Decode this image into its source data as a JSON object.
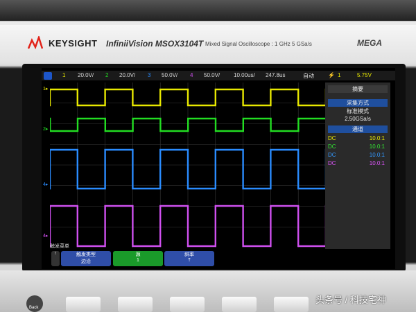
{
  "brand": {
    "name": "KEYSIGHT",
    "model": "InfiniiVision MSOX3104T",
    "spec": "Mixed Signal Oscilloscope : 1 GHz   5 GSa/s",
    "mega": "MEGA"
  },
  "status": {
    "ch1_num": "1",
    "ch1_scale": "20.0V/",
    "ch2_num": "2",
    "ch2_scale": "20.0V/",
    "ch3_num": "3",
    "ch3_scale": "50.0V/",
    "ch4_num": "4",
    "ch4_scale": "50.0V/",
    "timebase": "10.00us/",
    "delay": "247.8us",
    "mode": "自动",
    "trig_ch": "1",
    "trig_level": "5.75V"
  },
  "panel": {
    "title": "摘要",
    "acq_header": "采集方式",
    "acq_mode": "标准模式",
    "sample_rate": "2.50GSa/s",
    "chan_header": "通道",
    "channels": [
      {
        "coupling": "DC",
        "probe": "10.0:1",
        "color": "#f0f000"
      },
      {
        "coupling": "DC",
        "probe": "10.0:1",
        "color": "#33e633"
      },
      {
        "coupling": "DC",
        "probe": "10.0:1",
        "color": "#3399ff"
      },
      {
        "coupling": "DC",
        "probe": "10.0:1",
        "color": "#e055ff"
      }
    ]
  },
  "trigger_menu": {
    "title": "触发菜单",
    "type_label": "触发类型",
    "type_value": "边沿",
    "source_label": "源",
    "source_value": "1",
    "slope_label": "斜率"
  },
  "colors": {
    "ch1": "#e8e800",
    "ch2": "#22dd22",
    "ch3": "#2a8cff",
    "ch4": "#d050f0"
  },
  "watermark": "头条号 / 科技宅神",
  "back_key": "Back"
}
